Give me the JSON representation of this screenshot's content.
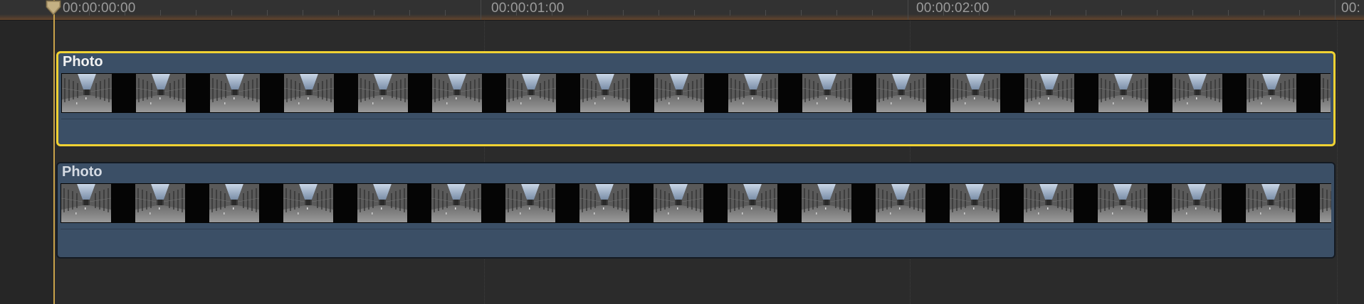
{
  "timeline": {
    "ruler": {
      "timecodes": [
        "00:00:00:00",
        "00:00:01:00",
        "00:00:02:00",
        "00:"
      ]
    },
    "clips": [
      {
        "title": "Photo",
        "selected": true,
        "thumbnail_icon": "gallery-photo-thumbnail"
      },
      {
        "title": "Photo",
        "selected": false,
        "thumbnail_icon": "gallery-photo-thumbnail"
      }
    ],
    "playhead": {
      "timecode": "00:00:00:00"
    }
  },
  "colors": {
    "clip_fill": "#3b4f66",
    "selection_outline": "#f0d233",
    "playhead": "#c9a24a",
    "ruler_tint": "#8c5528"
  }
}
